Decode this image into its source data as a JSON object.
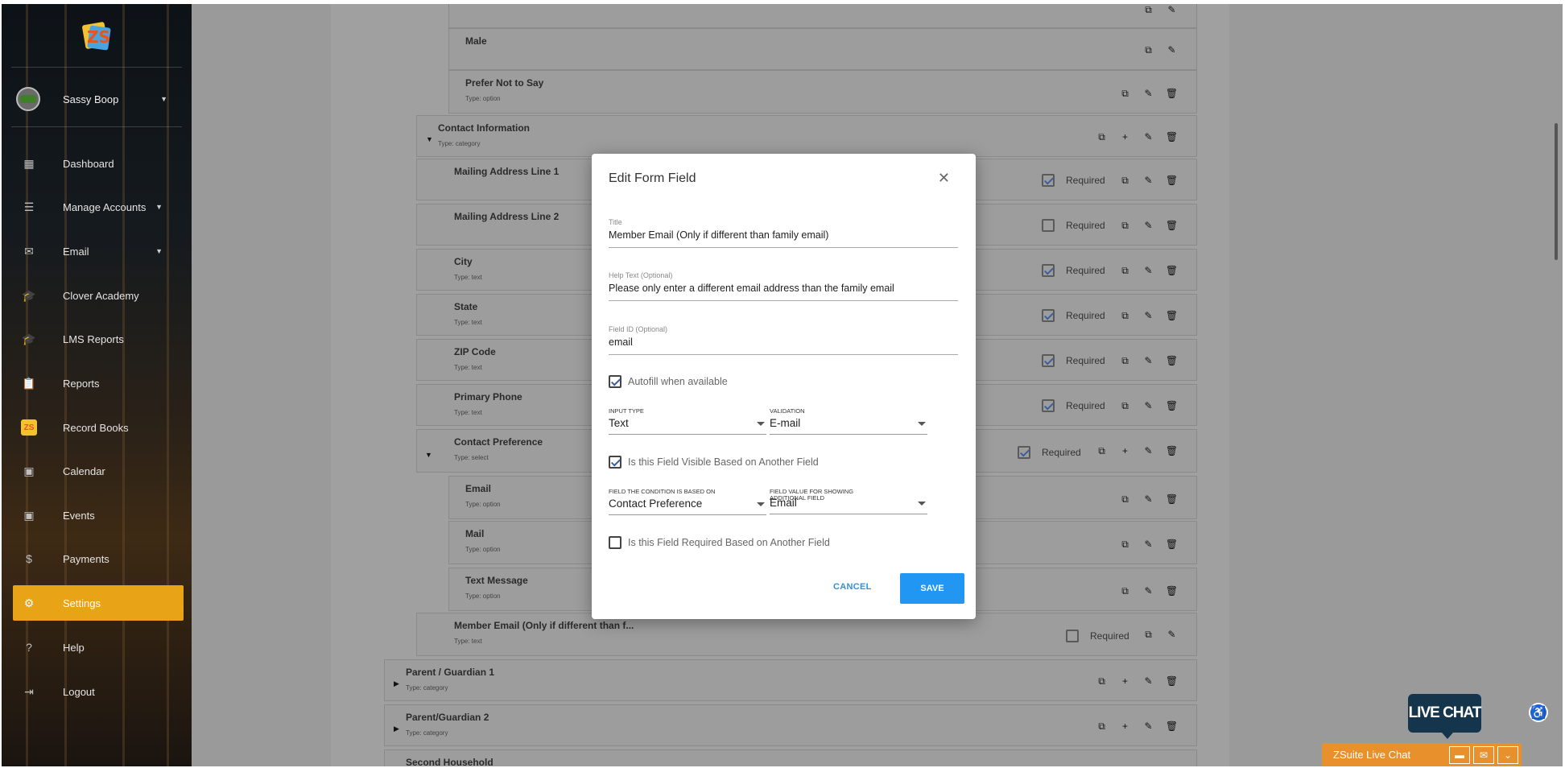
{
  "sidebar": {
    "user_name": "Sassy Boop",
    "items": [
      {
        "label": "Dashboard",
        "icon": "dashboard-icon"
      },
      {
        "label": "Manage Accounts",
        "icon": "list-icon"
      },
      {
        "label": "Email",
        "icon": "mail-icon"
      },
      {
        "label": "Clover Academy",
        "icon": "school-icon"
      },
      {
        "label": "LMS Reports",
        "icon": "school-icon"
      },
      {
        "label": "Reports",
        "icon": "clipboard-icon"
      },
      {
        "label": "Record Books",
        "icon": "zs-logo-icon"
      },
      {
        "label": "Calendar",
        "icon": "calendar-icon"
      },
      {
        "label": "Events",
        "icon": "event-icon"
      },
      {
        "label": "Payments",
        "icon": "dollar-icon"
      },
      {
        "label": "Settings",
        "icon": "gear-icon"
      },
      {
        "label": "Help",
        "icon": "help-icon"
      },
      {
        "label": "Logout",
        "icon": "logout-icon"
      }
    ],
    "active_color": "#e8a317"
  },
  "form_rows": {
    "male": "Male",
    "prefer": {
      "title": "Prefer Not to Say",
      "sub": "Type: option"
    },
    "contact_info": {
      "title": "Contact Information",
      "sub": "Type: category"
    },
    "mail1": {
      "title": "Mailing Address Line 1"
    },
    "mail2": {
      "title": "Mailing Address Line 2"
    },
    "city": {
      "title": "City",
      "sub": "Type: text"
    },
    "state": {
      "title": "State",
      "sub": "Type: text"
    },
    "zip": {
      "title": "ZIP Code",
      "sub": "Type: text"
    },
    "phone": {
      "title": "Primary Phone",
      "sub": "Type: text"
    },
    "contact_pref": {
      "title": "Contact Preference",
      "sub": "Type: select"
    },
    "email_opt": {
      "title": "Email",
      "sub": "Type: option"
    },
    "mail_opt": {
      "title": "Mail",
      "sub": "Type: option"
    },
    "text_opt": {
      "title": "Text Message",
      "sub": "Type: option"
    },
    "member_email": {
      "title": "Member Email (Only if different than f...",
      "sub": "Type: text"
    },
    "guardian1": {
      "title": "Parent / Guardian 1",
      "sub": "Type: category"
    },
    "guardian2": {
      "title": "Parent/Guardian 2",
      "sub": "Type: category"
    },
    "second_household": {
      "title": "Second Household"
    },
    "required_label": "Required"
  },
  "modal": {
    "title": "Edit Form Field",
    "title_field": {
      "label": "Title",
      "value": "Member Email (Only if different than family email)"
    },
    "help_field": {
      "label": "Help Text (Optional)",
      "value": "Please only enter a different email address than the family email"
    },
    "id_field": {
      "label": "Field ID (Optional)",
      "value": "email"
    },
    "autofill_label": "Autofill when available",
    "input_type": {
      "label": "INPUT TYPE",
      "value": "Text"
    },
    "validation": {
      "label": "VALIDATION",
      "value": "E-mail"
    },
    "visible_label": "Is this Field Visible Based on Another Field",
    "condition_field": {
      "label": "FIELD THE CONDITION IS BASED ON",
      "value": "Contact Preference"
    },
    "condition_value": {
      "label": "FIELD VALUE FOR SHOWING ADDITIONAL FIELD",
      "value": "Email"
    },
    "required_based_label": "Is this Field Required Based on Another Field",
    "cancel_label": "CANCEL",
    "save_label": "SAVE",
    "save_color": "#2196f3"
  },
  "chat": {
    "bubble_label": "LIVE CHAT",
    "bar_title": "ZSuite Live Chat"
  }
}
